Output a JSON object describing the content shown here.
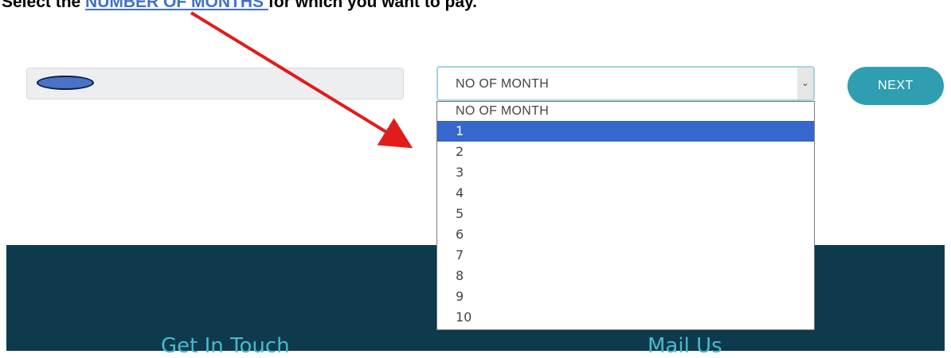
{
  "instruction": {
    "prefix": "Select the ",
    "highlight": "NUMBER OF MONTHS ",
    "suffix": "for which you want to pay."
  },
  "form": {
    "next_label": "NEXT",
    "select_value": "NO OF MONTH",
    "select_arrow": "⌄"
  },
  "dropdown": {
    "options": [
      "NO OF MONTH",
      "1",
      "2",
      "3",
      "4",
      "5",
      "6",
      "7",
      "8",
      "9",
      "10"
    ],
    "selected_option": "1"
  },
  "footer": {
    "get_in_touch": "Get In Touch",
    "mail_us": "Mail Us"
  },
  "colors": {
    "arrow": "#e21b1b",
    "next_button": "#2e9eb0",
    "footer_bg": "#0d3a4c",
    "footer_heading": "#4cb8cc",
    "highlight_row": "#3567cc",
    "instruction_highlight": "#4472c4"
  }
}
